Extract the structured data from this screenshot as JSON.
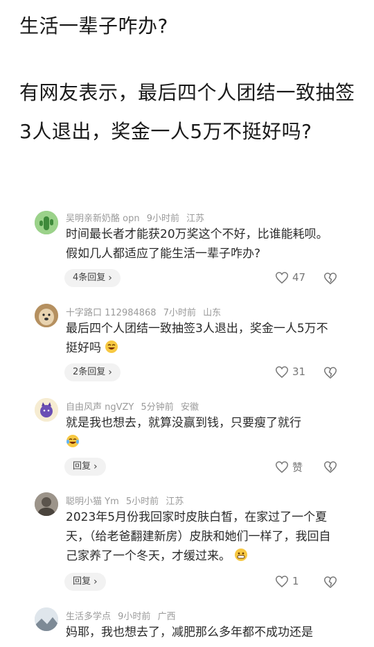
{
  "headline": {
    "line1": "生活一辈子咋办?",
    "line2": "有网友表示，最后四个人团结一致抽签3人退出，奖金一人5万不挺好吗?"
  },
  "comments": [
    {
      "user": "吴明亲新奶酪 opn",
      "time": "9小时前",
      "location": "江苏",
      "text": "时间最长者才能获20万奖这个不好，比谁能耗呗。假如几人都适应了能生活一辈子咋办?",
      "reply_label": "4条回复",
      "likes": "47"
    },
    {
      "user": "十字路口 112984868",
      "time": "7小时前",
      "location": "山东",
      "text": "最后四个人团结一致抽签3人退出，奖金一人5万不挺好吗",
      "reply_label": "2条回复",
      "likes": "31"
    },
    {
      "user": "自由风声 ngVZY",
      "time": "5分钟前",
      "location": "安徽",
      "text": "就是我也想去，就算没赢到钱，只要瘦了就行",
      "reply_label": "回复",
      "likes": "赞"
    },
    {
      "user": "聪明小猫 Ym",
      "time": "5小时前",
      "location": "江苏",
      "text": "2023年5月份我回家时皮肤白皙，在家过了一个夏天，（给老爸翻建新房）皮肤和她们一样了，我回自己家养了一个冬天，才缓过来。",
      "reply_label": "回复",
      "likes": "1"
    },
    {
      "user": "生活多学点",
      "time": "9小时前",
      "location": "广西",
      "text": "妈耶，我也想去了，减肥那么多年都不成功还是"
    }
  ],
  "icons": {
    "chevron": "chevron-right-icon",
    "like": "heart-icon",
    "dislike": "broken-heart-icon"
  },
  "colors": {
    "meta_text": "#9a9a9a",
    "button_bg": "#f2f2f2"
  }
}
